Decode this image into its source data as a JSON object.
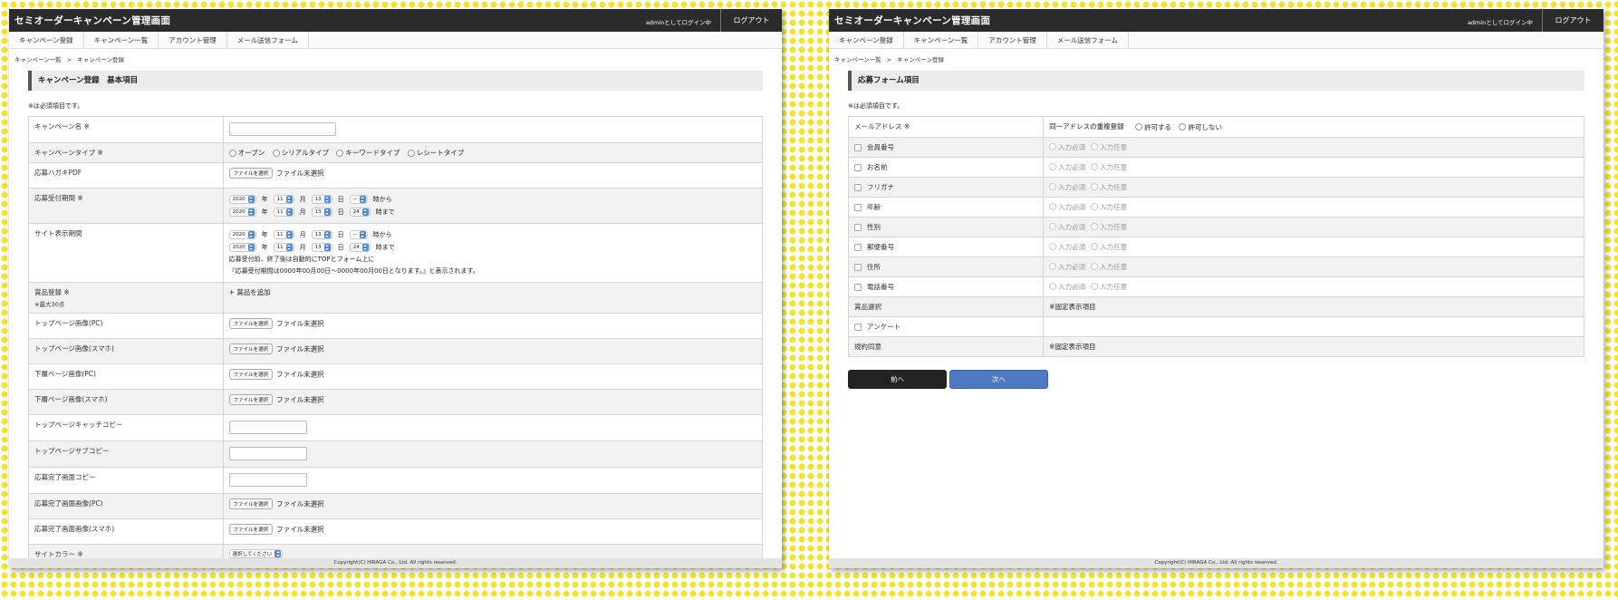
{
  "header": {
    "app_title": "セミオーダーキャンペーン管理画面",
    "login_status": "adminとしてログイン中",
    "logout_label": "ログアウト"
  },
  "nav": [
    "キャンペーン登録",
    "キャンペーン一覧",
    "アカウント管理",
    "メール送信フォーム"
  ],
  "breadcrumb": {
    "first": "キャンペーン一覧",
    "sep": ">",
    "second": "キャンペーン登録"
  },
  "required_note": "※は必須項目です。",
  "file_button_label": "ファイルを選択",
  "file_status": "ファイル未選択",
  "footer": "Copyright(C) HIRAGA Co., Ltd. All rights reserved.",
  "left": {
    "section_title": "キャンペーン登録　基本項目",
    "fields": {
      "name": "キャンペーン名 ※",
      "type": "キャンペーンタイプ ※",
      "postcard_pdf": "応募ハガキPDF",
      "entry_period": "応募受付期間 ※",
      "display_period": "サイト表示期間",
      "prize": "賞品登録 ※",
      "prize_sub": "※最大30点",
      "top_pc": "トップページ画像(PC)",
      "top_sp": "トップページ画像(スマホ)",
      "lower_pc": "下層ページ画像(PC)",
      "lower_sp": "下層ページ画像(スマホ)",
      "top_catch": "トップページキャッチコピー",
      "top_sub": "トップページサブコピー",
      "done_copy": "応募完了画面コピー",
      "done_pc": "応募完了画面画像(PC)",
      "done_sp": "応募完了画面画像(スマホ)",
      "site_color": "サイトカラー ※"
    },
    "campaign_types": [
      "オープン",
      "シリアルタイプ",
      "キーワードタイプ",
      "レシートタイプ"
    ],
    "date_units": {
      "year": "年",
      "month": "月",
      "day": "日",
      "from": "時から",
      "to": "時まで"
    },
    "date_from": {
      "year": "2020",
      "month": "11",
      "day": "13",
      "hour": "--"
    },
    "date_to": {
      "year": "2020",
      "month": "11",
      "day": "13",
      "hour": "24"
    },
    "display_note_1": "応募受付前、終了後は自動的にTOPとフォーム上に",
    "display_note_2": "『応募受付期間は0000年00月00日～0000年00月00日となります。』と表示されます。",
    "add_prize": "+ 賞品を追加",
    "color_placeholder": "選択してください"
  },
  "right": {
    "section_title": "応募フォーム項目",
    "email_label": "メールアドレス ※",
    "dup_label": "同一アドレスの重複登録",
    "dup_options": [
      "許可する",
      "許可しない"
    ],
    "fields": [
      "会員番号",
      "お名前",
      "フリガナ",
      "年齢",
      "性別",
      "郵便番号",
      "住所",
      "電話番号"
    ],
    "req_options": [
      "入力必須",
      "入力任意"
    ],
    "prize_label": "賞品選択",
    "fixed_label": "※固定表示項目",
    "survey_label": "アンケート",
    "terms_label": "規約同意",
    "back_label": "前へ",
    "next_label": "次へ"
  }
}
